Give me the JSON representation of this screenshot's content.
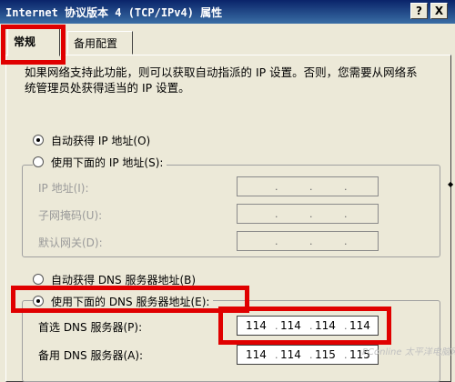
{
  "window": {
    "title": "Internet 协议版本 4 (TCP/IPv4) 属性",
    "help_label": "?",
    "close_label": "X"
  },
  "tabs": [
    {
      "label": "常规",
      "active": true
    },
    {
      "label": "备用配置",
      "active": false
    }
  ],
  "intro_text": "如果网络支持此功能，则可以获取自动指派的 IP 设置。否则，您需要从网络系统管理员处获得适当的 IP 设置。",
  "ip_options": {
    "auto": {
      "label": "自动获得 IP 地址(O)",
      "selected": true
    },
    "manual": {
      "label": "使用下面的 IP 地址(S):",
      "selected": false
    }
  },
  "ip_fields": [
    {
      "label": "IP 地址(I):",
      "value": "",
      "enabled": false
    },
    {
      "label": "子网掩码(U):",
      "value": "",
      "enabled": false
    },
    {
      "label": "默认网关(D):",
      "value": "",
      "enabled": false
    }
  ],
  "dns_options": {
    "auto": {
      "label": "自动获得 DNS 服务器地址(B)",
      "selected": false
    },
    "manual": {
      "label": "使用下面的 DNS 服务器地址(E):",
      "selected": true
    }
  },
  "dns_fields": [
    {
      "label": "首选 DNS 服务器(P):",
      "octets": [
        "114",
        "114",
        "114",
        "114"
      ],
      "enabled": true
    },
    {
      "label": "备用 DNS 服务器(A):",
      "octets": [
        "114",
        "114",
        "115",
        "115"
      ],
      "enabled": true
    }
  ],
  "watermark": "PConline 太平洋电脑网",
  "colors": {
    "highlight": "#e00000",
    "title_bar": "#0a246a"
  }
}
